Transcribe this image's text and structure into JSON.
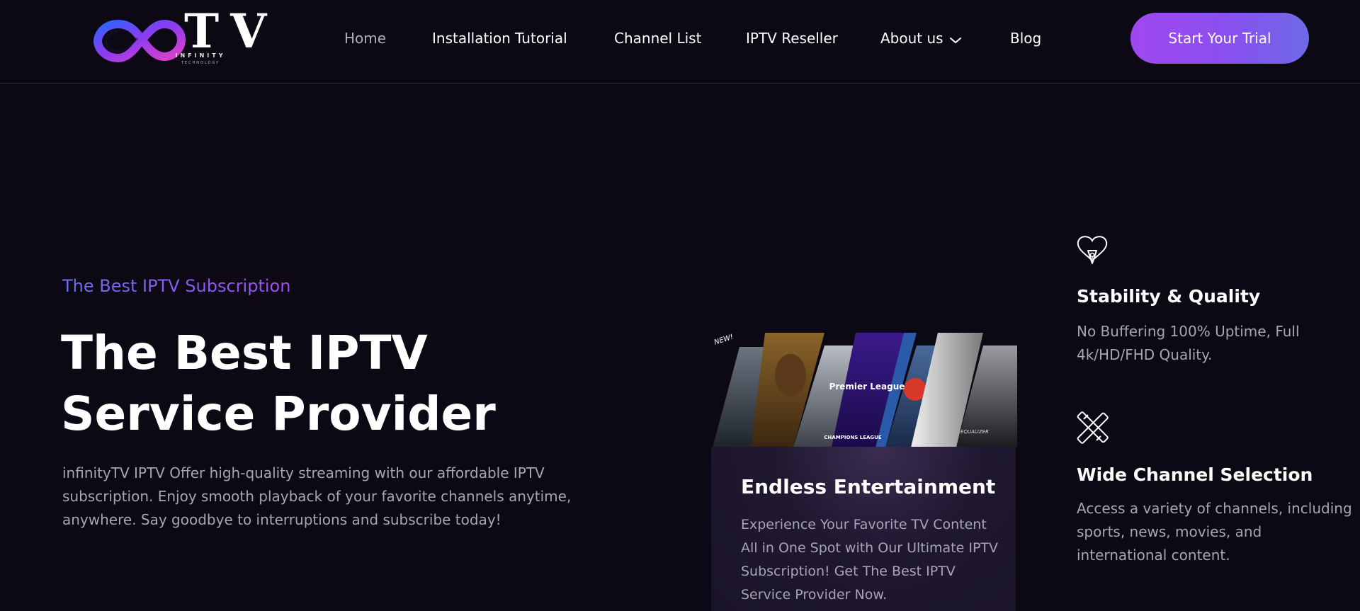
{
  "logo": {
    "mark": "TV",
    "sub1": "INFINITY",
    "sub2": "TECHNOLOGY",
    "icon": "infinity-icon"
  },
  "nav": {
    "items": [
      {
        "label": "Home",
        "active": true
      },
      {
        "label": "Installation Tutorial"
      },
      {
        "label": "Channel List"
      },
      {
        "label": "IPTV Reseller"
      },
      {
        "label": "About us",
        "dropdown": true,
        "icon": "chevron-down-icon"
      },
      {
        "label": "Blog"
      }
    ],
    "cta": "Start Your Trial"
  },
  "hero": {
    "eyebrow": "The Best IPTV Subscription",
    "title_line1": "The Best IPTV",
    "title_line2": "Service Provider",
    "description": "infinityTV IPTV Offer high-quality streaming with our affordable IPTV subscription. Enjoy smooth playback of your favorite channels anytime, anywhere. Say goodbye to interruptions and subscribe today!"
  },
  "card": {
    "badge": "NEW!",
    "poster_labels": [
      "Premier League",
      "CHAMPIONS LEAGUE",
      "EQUALIZER"
    ],
    "title": "Endless Entertainment",
    "text": "Experience Your Favorite TV Content All in One Spot with Our Ultimate IPTV Subscription! Get The Best IPTV Service Provider Now."
  },
  "features": [
    {
      "icon": "heart-pen-icon",
      "title": "Stability & Quality",
      "text": "No Buffering 100% Uptime, Full 4k/HD/FHD Quality."
    },
    {
      "icon": "crossed-tools-icon",
      "title": "Wide Channel Selection",
      "text": "Access a variety of channels, including sports, news, movies, and international content."
    }
  ],
  "colors": {
    "background": "#0c0814",
    "accent_start": "#a148f0",
    "accent_end": "#6c6ae6",
    "muted_text": "#a8a5b2"
  }
}
